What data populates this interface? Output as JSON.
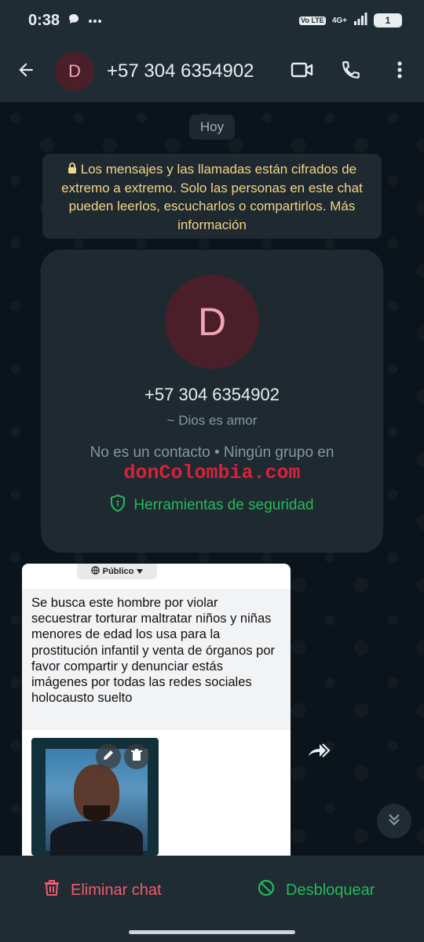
{
  "status_bar": {
    "time": "0:38",
    "network": "4G+",
    "volte": "Vo LTE",
    "battery": "1"
  },
  "header": {
    "avatar_letter": "D",
    "title": "+57 304 6354902",
    "icons": [
      "back-arrow-icon",
      "video-call-icon",
      "phone-icon",
      "more-vert-icon"
    ]
  },
  "chat": {
    "date_chip": "Hoy",
    "encryption_notice": "Los mensajes y las llamadas están cifrados de extremo a extremo. Solo las personas en este chat pueden leerlos, escucharlos o compartirlos.",
    "encryption_link": "Más información",
    "profile_card": {
      "avatar_letter": "D",
      "phone": "+57 304 6354902",
      "about": "~ Dios es amor",
      "info": "No es un contacto  •  Ningún grupo en",
      "watermark": "donColombia.com",
      "security_label": "Herramientas de seguridad"
    },
    "image_message": {
      "chip_label": "Público",
      "post_text": "Se busca este hombre por violar secuestrar torturar maltratar niños y niñas menores de edad los usa para la prostitución infantil y venta de órganos por favor compartir y denunciar estás imágenes por todas las redes sociales holocausto suelto"
    }
  },
  "bottom_actions": {
    "delete_label": "Eliminar chat",
    "unblock_label": "Desbloquear"
  },
  "colors": {
    "accent_green": "#26b95a",
    "danger_red": "#f15c6d",
    "notice_yellow": "#f5d38a",
    "bar_bg": "#1f2c34"
  }
}
